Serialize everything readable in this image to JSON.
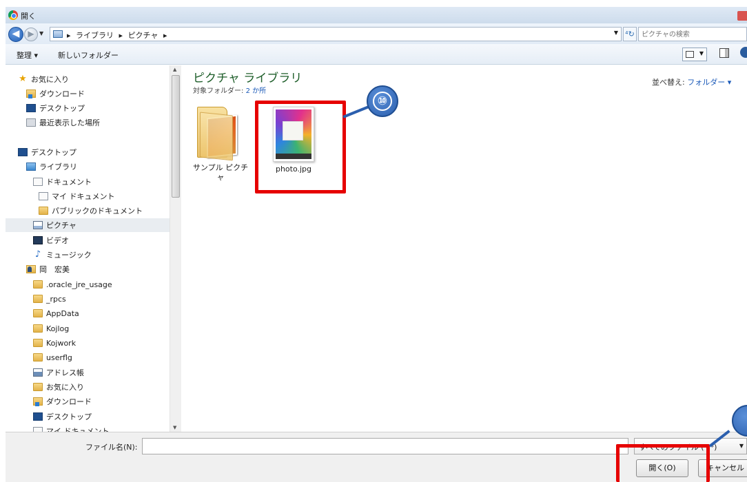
{
  "window": {
    "title": "開く"
  },
  "address": {
    "breadcrumbs": [
      "ライブラリ",
      "ピクチャ"
    ],
    "separator": "▸",
    "search_placeholder": "ピクチャの検索"
  },
  "toolbar": {
    "organize": "整理 ▾",
    "new_folder": "新しいフォルダー"
  },
  "nav": {
    "items": [
      {
        "label": "お気に入り",
        "icon": "star"
      },
      {
        "label": "ダウンロード",
        "icon": "folder-dl"
      },
      {
        "label": "デスクトップ",
        "icon": "desktop"
      },
      {
        "label": "最近表示した場所",
        "icon": "recent"
      },
      {
        "label": "デスクトップ",
        "icon": "desktop"
      },
      {
        "label": "ライブラリ",
        "icon": "library"
      },
      {
        "label": "ドキュメント",
        "icon": "doc"
      },
      {
        "label": "マイ ドキュメント",
        "icon": "doc"
      },
      {
        "label": "パブリックのドキュメント",
        "icon": "folder"
      },
      {
        "label": "ピクチャ",
        "icon": "pic",
        "selected": true
      },
      {
        "label": "ビデオ",
        "icon": "video"
      },
      {
        "label": "ミュージック",
        "icon": "music"
      },
      {
        "label": "岡　宏美",
        "icon": "user"
      },
      {
        "label": ".oracle_jre_usage",
        "icon": "folder"
      },
      {
        "label": "_rpcs",
        "icon": "folder"
      },
      {
        "label": "AppData",
        "icon": "folder"
      },
      {
        "label": "Kojlog",
        "icon": "folder"
      },
      {
        "label": "Kojwork",
        "icon": "folder"
      },
      {
        "label": "userflg",
        "icon": "folder"
      },
      {
        "label": "アドレス帳",
        "icon": "book"
      },
      {
        "label": "お気に入り",
        "icon": "folder"
      },
      {
        "label": "ダウンロード",
        "icon": "folder-dl"
      },
      {
        "label": "デスクトップ",
        "icon": "desktop"
      },
      {
        "label": "マイ ドキュメント",
        "icon": "doc"
      }
    ]
  },
  "content": {
    "library_title": "ピクチャ ライブラリ",
    "target_label": "対象フォルダー:",
    "target_count": "2 か所",
    "sort_label": "並べ替え:",
    "sort_value": "フォルダー ▾",
    "files": [
      {
        "name": "サンプル ピクチャ",
        "kind": "folder"
      },
      {
        "name": "photo.jpg",
        "kind": "image"
      }
    ]
  },
  "annotations": {
    "callout_file": "⑩"
  },
  "bottom": {
    "filename_label": "ファイル名(N):",
    "filename_value": "",
    "filter_value": "すべてのファイル (*.*)",
    "open_button": "開く(O)",
    "cancel_button": "キャンセル"
  },
  "colors": {
    "highlight_red": "#e60000",
    "callout_blue": "#2b5fae",
    "library_green": "#1e5e2a"
  }
}
